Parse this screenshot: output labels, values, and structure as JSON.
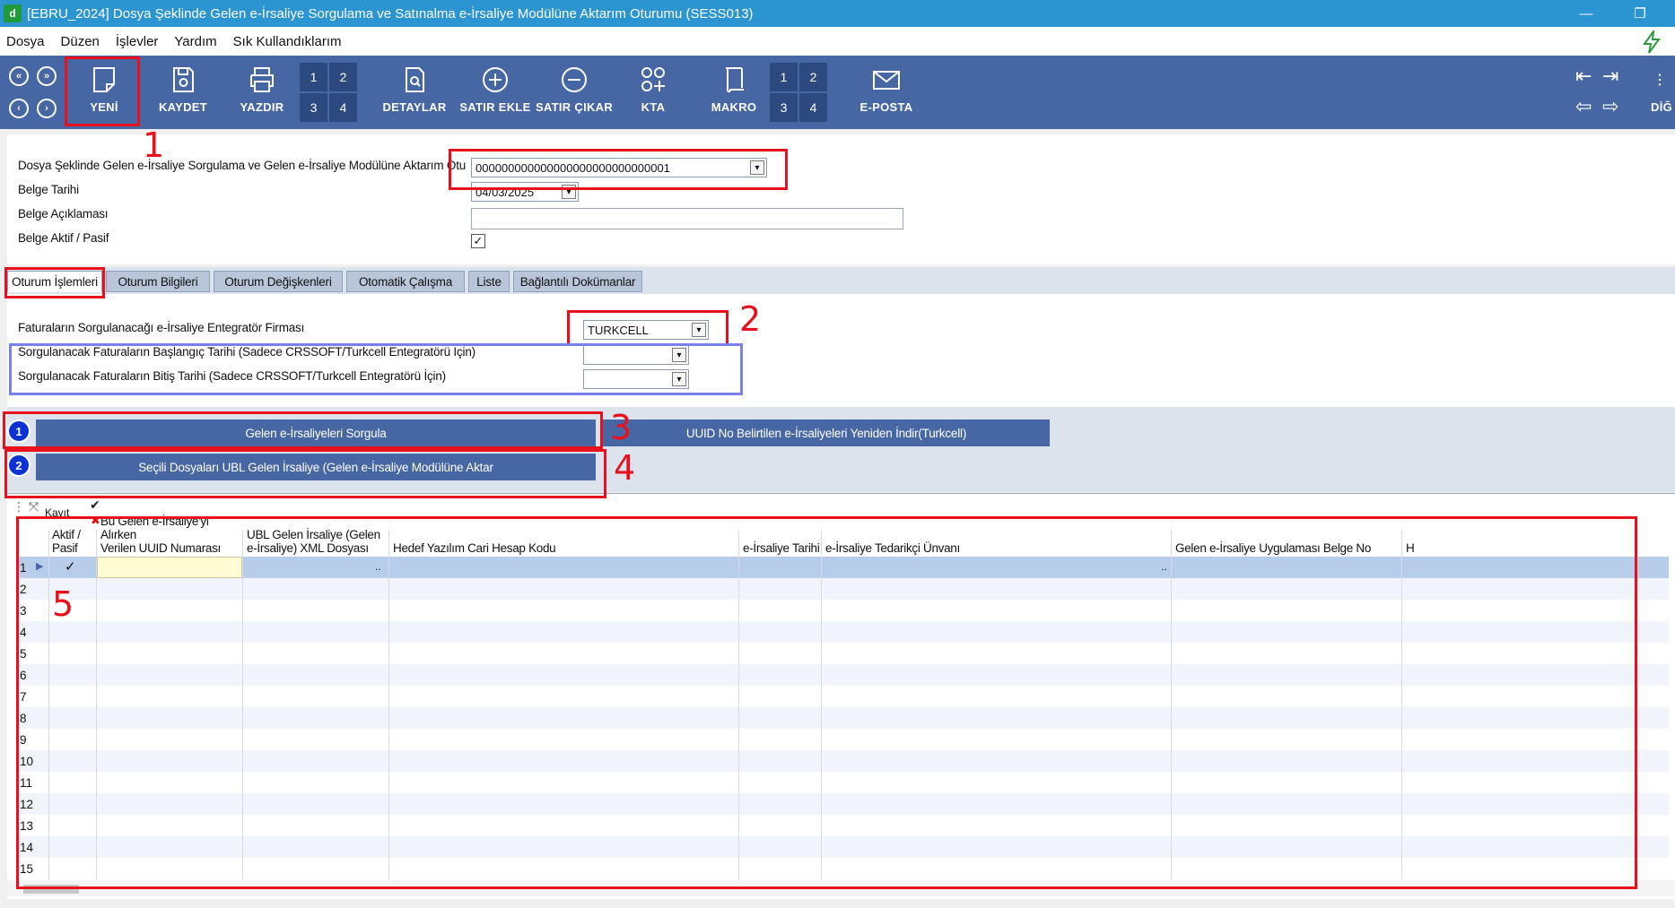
{
  "window": {
    "title": "[EBRU_2024] Dosya Şeklinde Gelen e-İrsaliye Sorgulama ve Satınalma e-İrsaliye Modülüne Aktarım Oturumu (SESS013)",
    "logo": "d",
    "minimize": "—",
    "restore": "❐"
  },
  "menu": [
    "Dosya",
    "Düzen",
    "İşlevler",
    "Yardım",
    "Sık Kullandıklarım"
  ],
  "toolbar": {
    "buttons": [
      {
        "label": "YENİ",
        "icon": "new-doc-icon"
      },
      {
        "label": "KAYDET",
        "icon": "save-icon"
      },
      {
        "label": "YAZDIR",
        "icon": "printer-icon"
      },
      {
        "label": "DETAYLAR",
        "icon": "details-icon"
      },
      {
        "label": "SATIR EKLE",
        "icon": "plus-circle-icon"
      },
      {
        "label": "SATIR ÇIKAR",
        "icon": "minus-circle-icon"
      },
      {
        "label": "KTA",
        "icon": "kta-icon"
      },
      {
        "label": "MAKRO",
        "icon": "macro-icon"
      },
      {
        "label": "E-POSTA",
        "icon": "mail-icon"
      },
      {
        "label": "DİĞ",
        "icon": "more-icon"
      }
    ],
    "numgrid1": [
      "1",
      "2",
      "3",
      "4"
    ],
    "numgrid2": [
      "1",
      "2",
      "3",
      "4"
    ]
  },
  "form": {
    "session_label": "Dosya Şeklinde Gelen e-İrsaliye Sorgulama ve Gelen e-İrsaliye Modülüne Aktarım Otu",
    "session_value": "000000000000000000000000000001",
    "date_label": "Belge Tarihi",
    "date_value": "04/03/2025",
    "desc_label": "Belge Açıklaması",
    "desc_value": "",
    "active_label": "Belge Aktif / Pasif",
    "active_checked": "✓"
  },
  "tabs": [
    "Oturum İşlemleri",
    "Oturum Bilgileri",
    "Oturum Değişkenleri",
    "Otomatik Çalışma",
    "Liste",
    "Bağlantılı Dokümanlar"
  ],
  "panel": {
    "integrator_label": "Faturaların Sorgulanacağı e-İrsaliye Entegratör Firması",
    "integrator_value": "TURKCELL",
    "start_label": "Sorgulanacak Faturaların Başlangıç Tarihi (Sadece CRSSOFT/Turkcell Entegratörü İçin)",
    "end_label": "Sorgulanacak Faturaların Bitiş Tarihi (Sadece CRSSOFT/Turkcell Entegratörü İçin)"
  },
  "actions": {
    "query_badge": "1",
    "query_label": "Gelen e-İrsaliyeleri Sorgula",
    "redownload_label": "UUID No Belirtilen e-İrsaliyeleri Yeniden İndir(Turkcell)",
    "transfer_badge": "2",
    "transfer_label": "Seçili Dosyaları UBL Gelen İrsaliye (Gelen e-İrsaliye Modülüne Aktar"
  },
  "grid": {
    "top_label": "Kayıt",
    "columns": [
      "Aktif /\nPasif",
      "Bu Gelen e-İrsaliye'yi Alırken\nVerilen UUID Numarası",
      "UBL Gelen İrsaliye (Gelen\ne-İrsaliye) XML Dosyası",
      "Hedef Yazılım Cari Hesap Kodu",
      "e-İrsaliye Tarihi",
      "e-İrsaliye Tedarikçi Ünvanı",
      "Gelen e-İrsaliye Uygulaması Belge No",
      "H"
    ],
    "row_numbers": [
      "1",
      "2",
      "3",
      "4",
      "5",
      "6",
      "7",
      "8",
      "9",
      "10",
      "11",
      "12",
      "13",
      "14",
      "15"
    ],
    "ellipsis": ".."
  },
  "annotations": [
    "1",
    "2",
    "3",
    "4",
    "5"
  ],
  "colors": {
    "titlebar": "#2b95d1",
    "toolbar": "#4767a4",
    "annotation_red": "#e8101c",
    "annotation_blue": "#7a7ff0"
  }
}
